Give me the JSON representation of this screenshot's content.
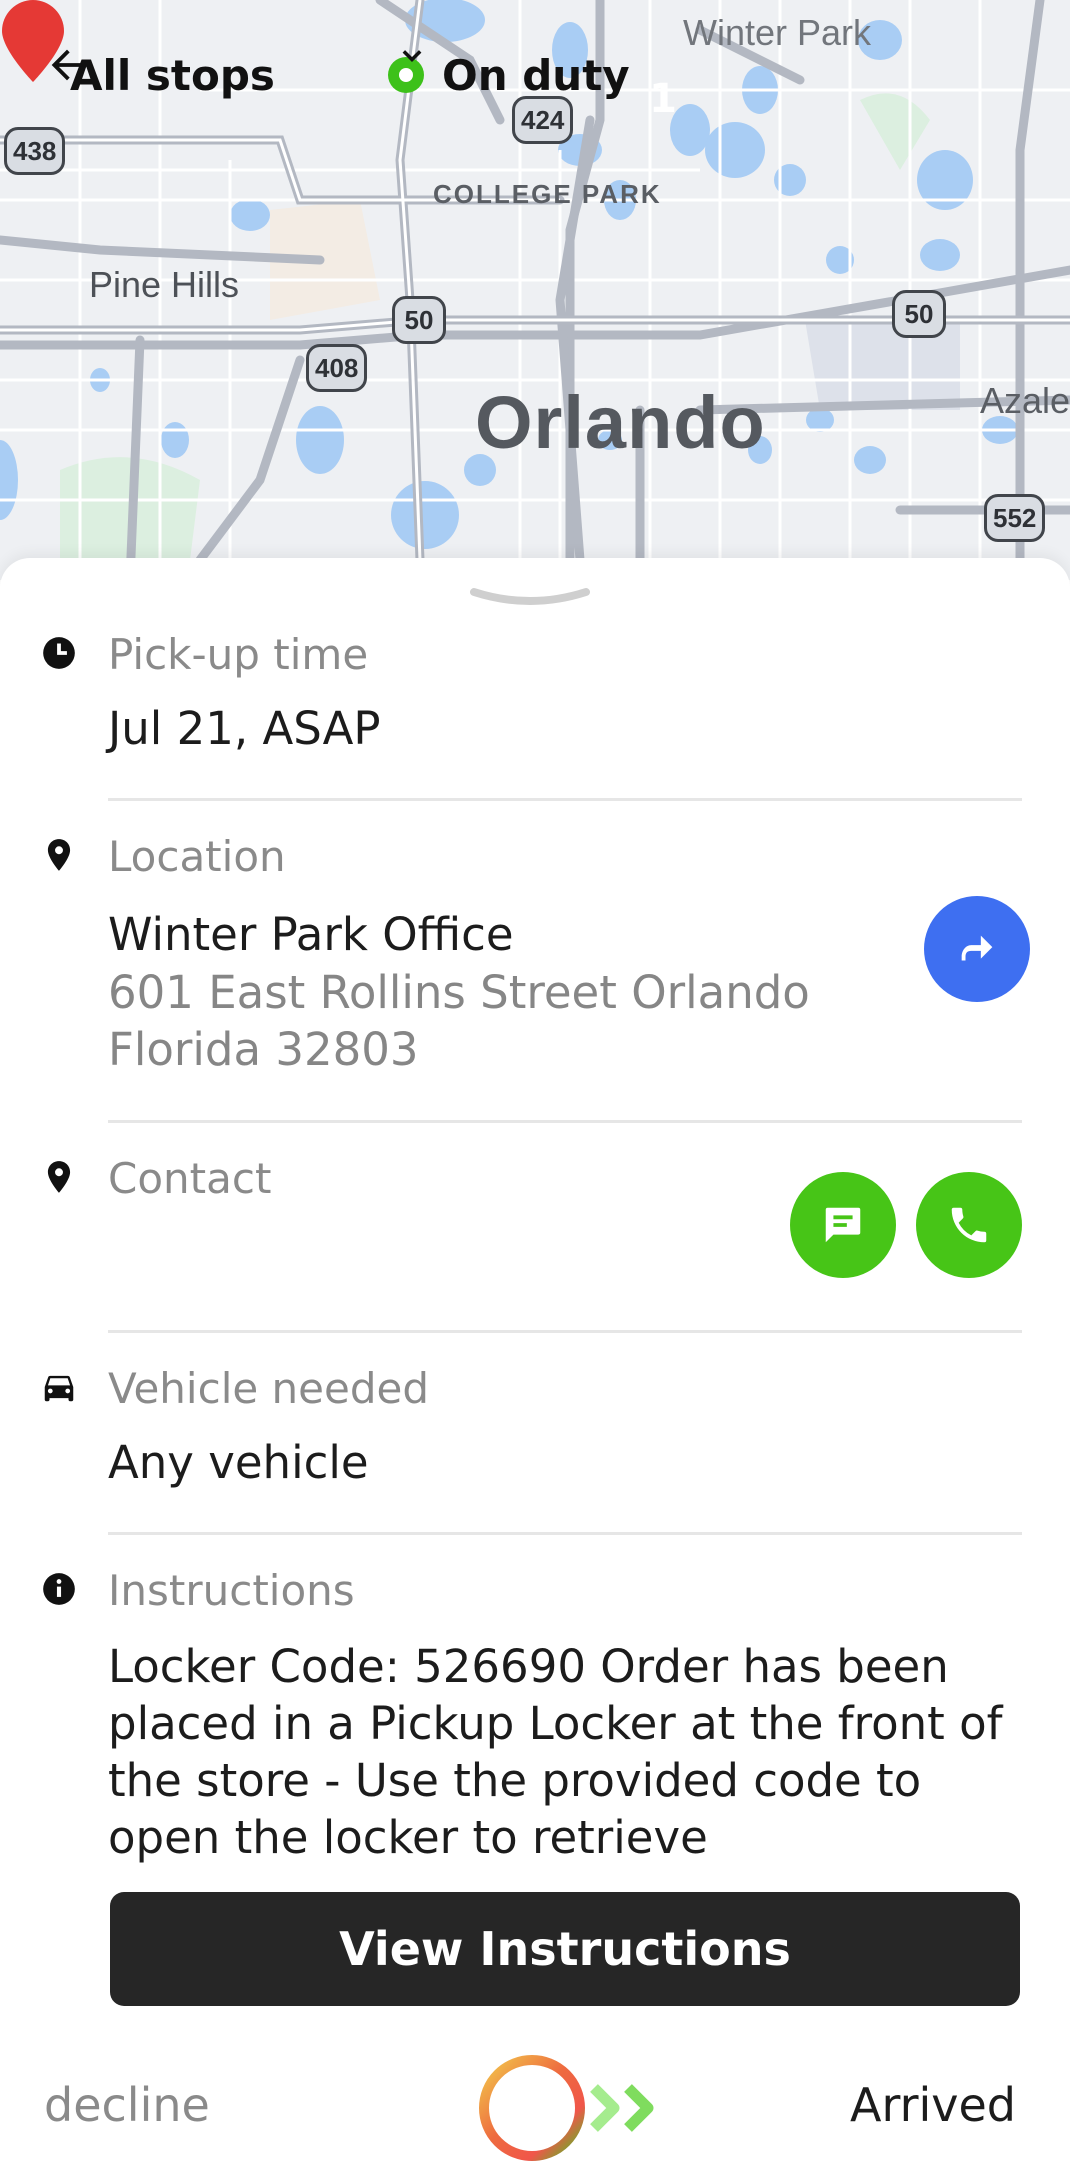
{
  "header": {
    "back_label": "All stops",
    "duty_status": "On duty",
    "duty_color": "#3dc11a"
  },
  "map": {
    "labels": {
      "pine_hills": "Pine Hills",
      "college_park": "COLLEGE PARK",
      "winter_park": "Winter Park",
      "orlando": "Orlando",
      "azalea": "Azale"
    },
    "shields": {
      "s438": "438",
      "s424": "424",
      "s50a": "50",
      "s408": "408",
      "s50b": "50",
      "s552": "552"
    },
    "pin_number": "1",
    "pin_color": "#e53935"
  },
  "details": {
    "pickup": {
      "title": "Pick-up time",
      "value": "Jul 21, ASAP"
    },
    "location": {
      "title": "Location",
      "name": "Winter Park Office",
      "address": "601 East Rollins Street Orlando Florida 32803"
    },
    "contact": {
      "title": "Contact"
    },
    "vehicle": {
      "title": "Vehicle needed",
      "value": "Any vehicle"
    },
    "instructions": {
      "title": "Instructions",
      "text": "Locker Code: 526690 Order has been placed in a Pickup Locker at the front of the store - Use the provided code to open the locker to retrieve",
      "button": "View Instructions"
    }
  },
  "footer": {
    "decline": "decline",
    "arrived": "Arrived"
  },
  "colors": {
    "accent_blue": "#3e6ff1",
    "accent_green": "#47c517",
    "button_dark": "#262626"
  }
}
